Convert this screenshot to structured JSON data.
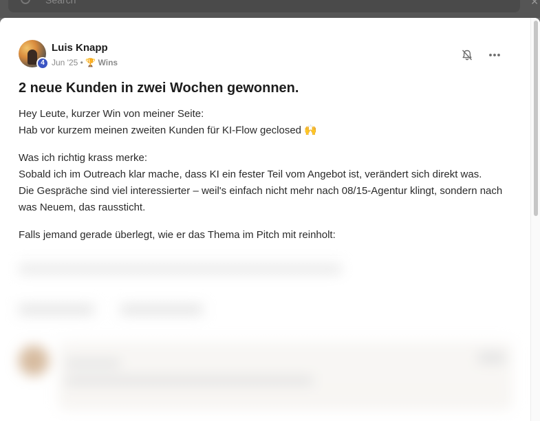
{
  "search": {
    "placeholder": "Search"
  },
  "post": {
    "author": "Luis Knapp",
    "level": "4",
    "date": "Jun '25",
    "separator": "•",
    "category_icon": "trophy-icon",
    "category": "Wins",
    "title": "2 neue Kunden in zwei Wochen gewonnen.",
    "paragraphs": [
      {
        "lines": [
          "Hey Leute, kurzer Win von meiner Seite:",
          "Hab vor kurzem meinen zweiten Kunden für KI-Flow geclosed 🙌"
        ]
      },
      {
        "lines": [
          "Was ich richtig krass merke:",
          "Sobald ich im Outreach klar mache, dass KI ein fester Teil vom Angebot ist, verändert sich direkt was.",
          "Die Gespräche sind viel interessierter – weil's einfach nicht mehr nach 08/15-Agentur klingt, sondern nach was Neuem, das raussticht."
        ]
      },
      {
        "lines": [
          "Falls jemand gerade überlegt, wie er das Thema im Pitch mit reinholt:"
        ]
      }
    ]
  },
  "icons": {
    "bell": "bell-off-icon",
    "more": "more-horizontal-icon",
    "search": "search-icon",
    "close": "close-icon"
  },
  "colors": {
    "badge": "#3b55c4",
    "title": "#1d1d1d",
    "meta": "#8a8a8a"
  }
}
